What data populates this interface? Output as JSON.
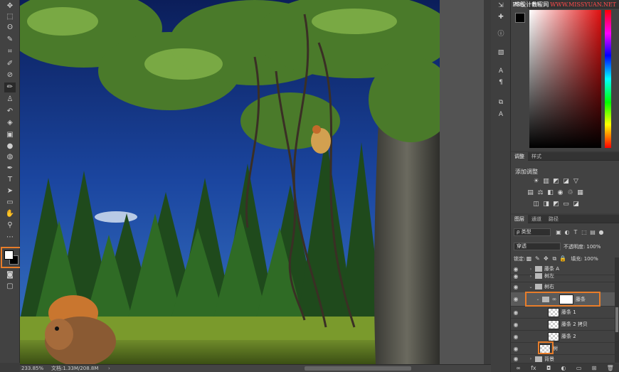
{
  "toolbar": {
    "tools": [
      "move-icon",
      "marquee-icon",
      "lasso-icon",
      "magic-wand-icon",
      "crop-icon",
      "eyedropper-icon",
      "healing-icon",
      "brush-icon",
      "stamp-icon",
      "history-brush-icon",
      "eraser-icon",
      "gradient-icon",
      "blur-icon",
      "dodge-icon",
      "pen-icon",
      "type-icon",
      "path-select-icon",
      "shape-icon",
      "hand-icon",
      "zoom-icon",
      "more-icon"
    ],
    "active_tool": "brush-icon",
    "foreground": "#ffffff",
    "background": "#000000",
    "highlight_color": "#e87d2a"
  },
  "status": {
    "zoom": "233.85%",
    "doc": "文档:1.33M/208.8M",
    "arrow": "›"
  },
  "color_panel": {
    "tabs": [
      "颜色",
      "色板"
    ],
    "watermark_prefix": "PS设计教程网",
    "watermark_brand": "WWW.MISSYUAN.NET",
    "hue_color": "#e01010"
  },
  "adjust_panel": {
    "tabs": [
      "调整",
      "样式"
    ],
    "title": "添加调整"
  },
  "layers_panel": {
    "tabs": [
      "图层",
      "通道",
      "路径"
    ],
    "filter_type": "ρ 类型",
    "blend_mode": "穿透",
    "opacity_label": "不透明度:",
    "opacity_value": "100%",
    "lock_label": "锁定:",
    "fill_label": "填充:",
    "fill_value": "100%",
    "layers": [
      {
        "name": "藤条 A",
        "kind": "group-collapsed",
        "indent": 1
      },
      {
        "name": "树左",
        "kind": "group-collapsed",
        "indent": 1
      },
      {
        "name": "树右",
        "kind": "group-expanded",
        "indent": 1
      },
      {
        "name": "藤条",
        "kind": "group-mask",
        "indent": 2,
        "selected": true
      },
      {
        "name": "藤条 1",
        "kind": "layer",
        "indent": 3
      },
      {
        "name": "藤条 2 拷贝",
        "kind": "layer",
        "indent": 3
      },
      {
        "name": "藤条 2",
        "kind": "layer",
        "indent": 3
      },
      {
        "name": "树",
        "kind": "layer-plain",
        "indent": 2
      },
      {
        "name": "背景",
        "kind": "group-collapsed",
        "indent": 1
      }
    ]
  }
}
